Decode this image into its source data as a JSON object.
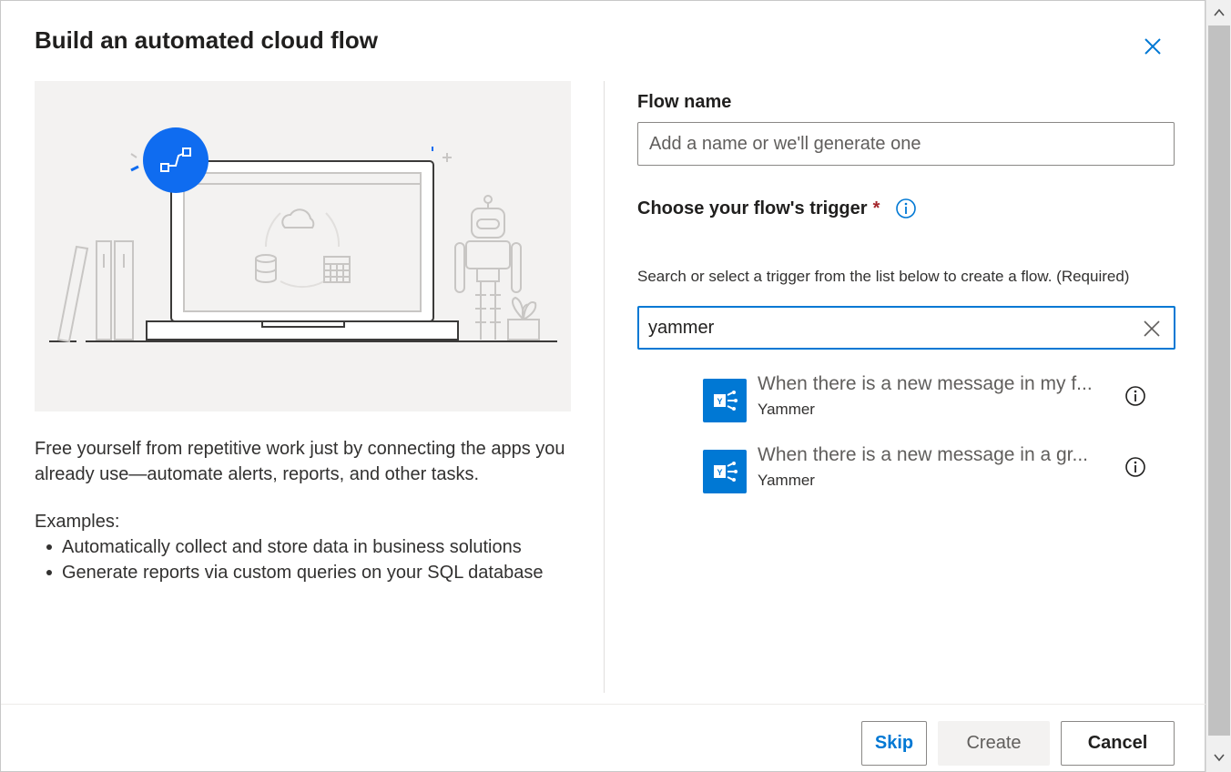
{
  "dialog": {
    "title": "Build an automated cloud flow",
    "close_icon": "close-icon"
  },
  "left": {
    "description": "Free yourself from repetitive work just by connecting the apps you already use—automate alerts, reports, and other tasks.",
    "examples_label": "Examples:",
    "examples": [
      "Automatically collect and store data in business solutions",
      "Generate reports via custom queries on your SQL database"
    ]
  },
  "form": {
    "flow_name_label": "Flow name",
    "flow_name_value": "",
    "flow_name_placeholder": "Add a name or we'll generate one",
    "trigger_label": "Choose your flow's trigger",
    "required_marker": "*",
    "helper_text": "Search or select a trigger from the list below to create a flow. (Required)",
    "search_value": "yammer"
  },
  "triggers": [
    {
      "title": "When there is a new message in my f...",
      "connector": "Yammer",
      "icon": "yammer-icon"
    },
    {
      "title": "When there is a new message in a gr...",
      "connector": "Yammer",
      "icon": "yammer-icon"
    }
  ],
  "footer": {
    "skip_label": "Skip",
    "create_label": "Create",
    "cancel_label": "Cancel"
  },
  "colors": {
    "accent": "#0078d4",
    "required": "#a4262c",
    "illustration_bg": "#f3f2f1"
  }
}
